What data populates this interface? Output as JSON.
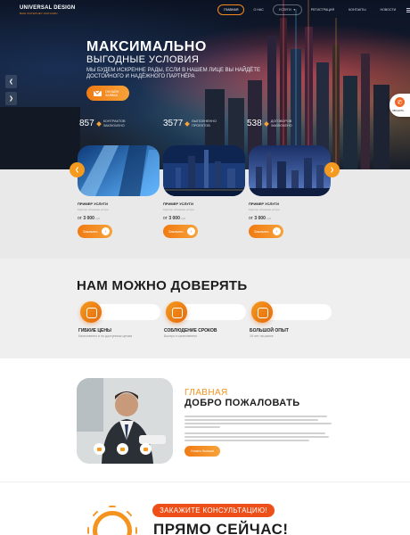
{
  "brand": {
    "name": "UNIVERSAL DESIGN",
    "tagline": "ВАШ ИНТЕРНЕТ-МАГАЗИН"
  },
  "nav": {
    "items": [
      "ГЛАВНАЯ",
      "О НАС",
      "УСЛУГИ",
      "РЕГИСТРАЦИЯ",
      "КОНТАКТЫ",
      "НОВОСТИ"
    ],
    "active": "ГЛАВНАЯ",
    "more": "ЕЩЁ"
  },
  "hero": {
    "title": "МАКСИМАЛЬНО",
    "subtitle": "ВЫГОДНЫЕ УСЛОВИЯ",
    "text": "МЫ БУДЕМ ИСКРЕННЕ РАДЫ, ЕСЛИ В НАШЕМ ЛИЦЕ ВЫ НАЙДЁТЕ ДОСТОЙНОГО И НАДЁЖНОГО ПАРТНЁРА",
    "button": "ОНЛАЙН ЗАЯВКА",
    "stats": [
      {
        "number": "857",
        "label": "КОНТРАКТОВ ЗАКЛЮЧЕНО"
      },
      {
        "number": "3577",
        "label": "ВЫПОЛНЕННО ПРОЕКТОВ"
      },
      {
        "number": "538",
        "label": "ДОГОВОРОВ ЗАКЛЮЧЕНО"
      }
    ],
    "phone_label": "ЗВОНИТЬ"
  },
  "services": {
    "items": [
      {
        "title": "ПРИМЕР УСЛУГИ",
        "desc": "Краткое описание услуги",
        "price_prefix": "от",
        "price": "3 000",
        "currency": "руб.",
        "button": "Заказать"
      },
      {
        "title": "ПРИМЕР УСЛУГИ",
        "desc": "Краткое описание услуги",
        "price_prefix": "от",
        "price": "3 000",
        "currency": "руб.",
        "button": "Заказать"
      },
      {
        "title": "ПРИМЕР УСЛУГИ",
        "desc": "Краткое описание услуги",
        "price_prefix": "от",
        "price": "3 000",
        "currency": "руб.",
        "button": "Заказать"
      }
    ]
  },
  "trust": {
    "title": "НАМ МОЖНО ДОВЕРЯТЬ",
    "features": [
      {
        "title": "ГИБКИЕ ЦЕНЫ",
        "desc": "Качественно и по доступным ценам",
        "icon": "price-icon"
      },
      {
        "title": "СОБЛЮДЕНИЕ СРОКОВ",
        "desc": "Быстро и качественно",
        "icon": "clock-icon"
      },
      {
        "title": "БОЛЬШОЙ ОПЫТ",
        "desc": "10 лет на рынке",
        "icon": "experience-icon"
      }
    ]
  },
  "welcome": {
    "kicker": "ГЛАВНАЯ",
    "title": "ДОБРО ПОЖАЛОВАТЬ",
    "button": "Узнать больше"
  },
  "consult": {
    "badge": "ЗАКАЖИТЕ КОНСУЛЬТАЦИЮ!",
    "title": "ПРЯМО СЕЙЧАС!"
  },
  "colors": {
    "accent": "#f5931f",
    "accent_dark": "#ee4e17",
    "hero_bg": "#111a2c"
  }
}
